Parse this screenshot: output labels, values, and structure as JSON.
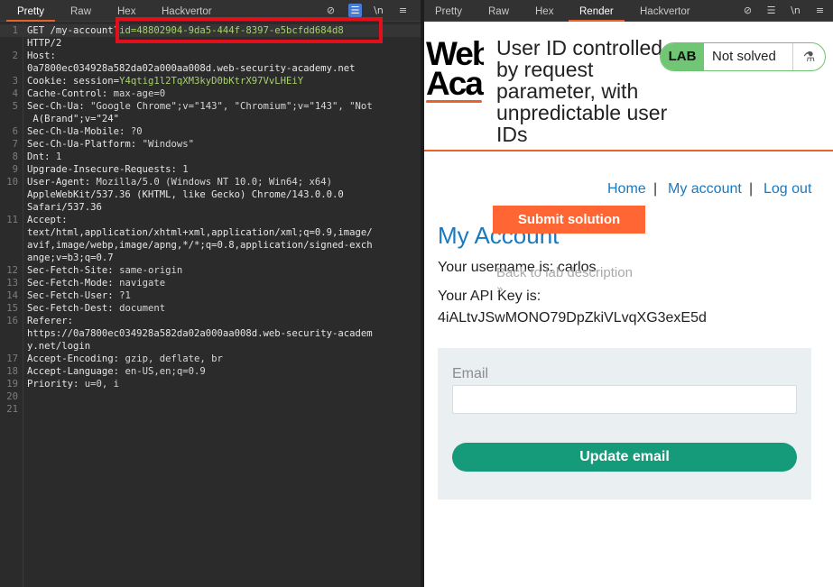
{
  "left_tabs": [
    "Pretty",
    "Raw",
    "Hex",
    "Hackvertor"
  ],
  "left_toolbar_icons": [
    "eye-off-icon",
    "wrap-lines-icon",
    "newline-icon",
    "menu-icon"
  ],
  "request_lines": [
    {
      "n": "1",
      "k": "GET /my-account?",
      "v": "id=48802904-9da5-444f-8397-e5bcfdd684d8",
      "g": true
    },
    {
      "n": "",
      "k": "HTTP/2",
      "v": ""
    },
    {
      "n": "2",
      "k": "Host:",
      "v": ""
    },
    {
      "n": "",
      "k": "0a7800ec034928a582da02a000aa008d.web-security-academy.net",
      "v": ""
    },
    {
      "n": "3",
      "k": "Cookie: session=",
      "v": "Y4qtig1l2TqXM3kyD0bKtrX97VvLHEiY",
      "g": true
    },
    {
      "n": "4",
      "k": "Cache-Control: ",
      "v": "max-age=0"
    },
    {
      "n": "5",
      "k": "Sec-Ch-Ua: ",
      "v": "\"Google Chrome\";v=\"143\", \"Chromium\";v=\"143\", \"Not"
    },
    {
      "n": "",
      "k": " A(Brand\";v=\"24\"",
      "v": ""
    },
    {
      "n": "6",
      "k": "Sec-Ch-Ua-Mobile: ",
      "v": "?0"
    },
    {
      "n": "7",
      "k": "Sec-Ch-Ua-Platform: ",
      "v": "\"Windows\""
    },
    {
      "n": "8",
      "k": "Dnt: ",
      "v": "1"
    },
    {
      "n": "9",
      "k": "Upgrade-Insecure-Requests: ",
      "v": "1"
    },
    {
      "n": "10",
      "k": "User-Agent: ",
      "v": "Mozilla/5.0 (Windows NT 10.0; Win64; x64)"
    },
    {
      "n": "",
      "k": "AppleWebKit/537.36 (KHTML, like Gecko) Chrome/143.0.0.0",
      "v": ""
    },
    {
      "n": "",
      "k": "Safari/537.36",
      "v": ""
    },
    {
      "n": "11",
      "k": "Accept:",
      "v": ""
    },
    {
      "n": "",
      "k": "text/html,application/xhtml+xml,application/xml;q=0.9,image/",
      "v": ""
    },
    {
      "n": "",
      "k": "avif,image/webp,image/apng,*/*;q=0.8,application/signed-exch",
      "v": ""
    },
    {
      "n": "",
      "k": "ange;v=b3;q=0.7",
      "v": ""
    },
    {
      "n": "12",
      "k": "Sec-Fetch-Site: ",
      "v": "same-origin"
    },
    {
      "n": "13",
      "k": "Sec-Fetch-Mode: ",
      "v": "navigate"
    },
    {
      "n": "14",
      "k": "Sec-Fetch-User: ",
      "v": "?1"
    },
    {
      "n": "15",
      "k": "Sec-Fetch-Dest: ",
      "v": "document"
    },
    {
      "n": "16",
      "k": "Referer:",
      "v": ""
    },
    {
      "n": "",
      "k": "https://0a7800ec034928a582da02a000aa008d.web-security-academ",
      "v": ""
    },
    {
      "n": "",
      "k": "y.net/login",
      "v": ""
    },
    {
      "n": "17",
      "k": "Accept-Encoding: ",
      "v": "gzip, deflate, br"
    },
    {
      "n": "18",
      "k": "Accept-Language: ",
      "v": "en-US,en;q=0.9"
    },
    {
      "n": "19",
      "k": "Priority: ",
      "v": "u=0, i"
    },
    {
      "n": "20",
      "k": "",
      "v": ""
    },
    {
      "n": "21",
      "k": "",
      "v": ""
    }
  ],
  "right_tabs": [
    "Pretty",
    "Raw",
    "Hex",
    "Render",
    "Hackvertor"
  ],
  "right_active_tab": "Render",
  "page": {
    "logo_text_line1": "Web",
    "logo_text_line2": "Aca",
    "lab_title": "User ID controlled by request parameter, with unpredictable user IDs",
    "lab_badge": "LAB",
    "lab_status": "Not solved",
    "flask_icon": "⚗",
    "nav": [
      "Home",
      "My account",
      "Log out"
    ],
    "nav_sep": "|",
    "submit_label": "Submit solution",
    "back_label": "Back to lab description",
    "back_chevron": "»",
    "title": "My Account",
    "username_line": "Your username is: carlos",
    "api_key_label": "Your API Key is:",
    "api_key": "4iALtvJSwMONO79DpZkiVLvqXG3exE5d",
    "email_label": "Email",
    "email_value": "",
    "update_label": "Update email"
  },
  "colors": {
    "burp_accent": "#e8632b",
    "highlight_box": "#e3101b",
    "link_blue": "#1a79bf",
    "lab_green": "#70c674",
    "submit_orange": "#ff6633",
    "update_teal": "#159a7a"
  }
}
